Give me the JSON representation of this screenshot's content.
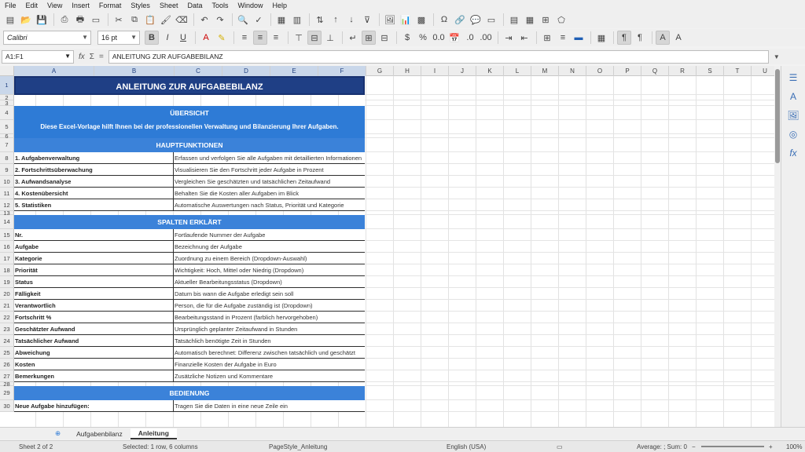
{
  "menu": [
    "File",
    "Edit",
    "View",
    "Insert",
    "Format",
    "Styles",
    "Sheet",
    "Data",
    "Tools",
    "Window",
    "Help"
  ],
  "font": {
    "name": "Calibri",
    "size": "16 pt"
  },
  "formula_bar": {
    "cell_ref": "A1:F1",
    "sum_icon": "Σ",
    "equals": "=",
    "content": "ANLEITUNG ZUR AUFGABEBILANZ"
  },
  "columns": [
    "A",
    "B",
    "C",
    "D",
    "E",
    "F",
    "G",
    "H",
    "I",
    "J",
    "K",
    "L",
    "M",
    "N",
    "O",
    "P",
    "Q",
    "R",
    "S",
    "T",
    "U"
  ],
  "rows_numbers": [
    "1",
    "2",
    "3",
    "4",
    "5",
    "6",
    "7",
    "8",
    "9",
    "10",
    "11",
    "12",
    "13",
    "14",
    "15",
    "16",
    "17",
    "18",
    "19",
    "20",
    "21",
    "22",
    "23",
    "24",
    "25",
    "26",
    "27",
    "28",
    "29",
    "30"
  ],
  "sheet": {
    "title": "ANLEITUNG ZUR AUFGABEBILANZ",
    "overview_header": "ÜBERSICHT",
    "overview_text": "Diese Excel-Vorlage hilft Ihnen bei der professionellen Verwaltung und Bilanzierung Ihrer Aufgaben.",
    "functions_header": "HAUPTFUNKTIONEN",
    "functions": [
      {
        "k": "1. Aufgabenverwaltung",
        "v": "Erfassen und verfolgen Sie alle Aufgaben mit detaillierten Informationen"
      },
      {
        "k": "2. Fortschrittsüberwachung",
        "v": "Visualisieren Sie den Fortschritt jeder Aufgabe in Prozent"
      },
      {
        "k": "3. Aufwandsanalyse",
        "v": "Vergleichen Sie geschätzten und tatsächlichen Zeitaufwand"
      },
      {
        "k": "4. Kostenübersicht",
        "v": "Behalten Sie die Kosten aller Aufgaben im Blick"
      },
      {
        "k": "5. Statistiken",
        "v": "Automatische Auswertungen nach Status, Priorität und Kategorie"
      }
    ],
    "columns_header": "SPALTEN ERKLÄRT",
    "columns_explained": [
      {
        "k": "Nr.",
        "v": "Fortlaufende Nummer der Aufgabe"
      },
      {
        "k": "Aufgabe",
        "v": "Bezeichnung der Aufgabe"
      },
      {
        "k": "Kategorie",
        "v": "Zuordnung zu einem Bereich (Dropdown-Auswahl)"
      },
      {
        "k": "Priorität",
        "v": "Wichtigkeit: Hoch, Mittel oder Niedrig (Dropdown)"
      },
      {
        "k": "Status",
        "v": "Aktueller Bearbeitungsstatus (Dropdown)"
      },
      {
        "k": "Fälligkeit",
        "v": "Datum bis wann die Aufgabe erledigt sein soll"
      },
      {
        "k": "Verantwortlich",
        "v": "Person, die für die Aufgabe zuständig ist (Dropdown)"
      },
      {
        "k": "Fortschritt %",
        "v": "Bearbeitungsstand in Prozent (farblich hervorgehoben)"
      },
      {
        "k": "Geschätzter Aufwand",
        "v": "Ursprünglich geplanter Zeitaufwand in Stunden"
      },
      {
        "k": "Tatsächlicher Aufwand",
        "v": "Tatsächlich benötigte Zeit in Stunden"
      },
      {
        "k": "Abweichung",
        "v": "Automatisch berechnet: Differenz zwischen tatsächlich und geschätzt"
      },
      {
        "k": "Kosten",
        "v": "Finanzielle Kosten der Aufgabe in Euro"
      },
      {
        "k": "Bemerkungen",
        "v": "Zusätzliche Notizen und Kommentare"
      }
    ],
    "operation_header": "BEDIENUNG",
    "operation": [
      {
        "k": "Neue Aufgabe hinzufügen:",
        "v": "Tragen Sie die Daten in eine neue Zeile ein"
      }
    ]
  },
  "tabs": {
    "add": "⊕",
    "first": "Aufgabenbilanz",
    "second": "Anleitung"
  },
  "status": {
    "sheet": "Sheet 2 of 2",
    "selection": "Selected: 1 row, 6 columns",
    "page_style": "PageStyle_Anleitung",
    "language": "English (USA)",
    "summary": "Average: ; Sum: 0",
    "zoom": "100%"
  },
  "colors": {
    "title_bg": "#1f3f85",
    "section_bg": "#3b82d9",
    "accent": "#2e7bd6"
  }
}
